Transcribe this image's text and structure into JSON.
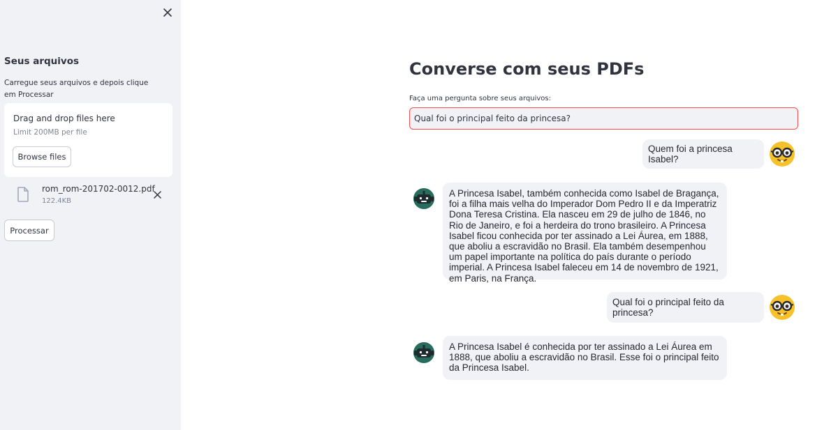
{
  "sidebar": {
    "close_icon": "close-icon",
    "title": "Seus arquivos",
    "caption": "Carregue seus arquivos e depois clique em Processar",
    "uploader": {
      "drag_text": "Drag and drop files here",
      "limit_text": "Limit 200MB per file",
      "browse_label": "Browse files"
    },
    "file": {
      "icon": "file-icon",
      "name": "rom_rom-201702-0012.pdf",
      "size": "122.4KB"
    },
    "process_label": "Processar"
  },
  "main": {
    "title": "Converse com seus PDFs",
    "question_label": "Faça uma pergunta sobre seus arquivos:",
    "question_value": "Qual foi o principal feito da princesa?"
  },
  "chat": [
    {
      "role": "user",
      "avatar": "nerd-face-avatar",
      "text": "Quem foi a princesa Isabel?"
    },
    {
      "role": "bot",
      "avatar": "robot-avatar",
      "text": "A Princesa Isabel, também conhecida como Isabel de Bragança, foi a filha mais velha do Imperador Dom Pedro II e da Imperatriz Dona Teresa Cristina. Ela nasceu em 29 de julho de 1846, no Rio de Janeiro, e foi a herdeira do trono brasileiro. A Princesa Isabel ficou conhecida por ter assinado a Lei Áurea, em 1888, que aboliu a escravidão no Brasil. Ela também desempenhou um papel importante na política do país durante o período imperial. A Princesa Isabel faleceu em 14 de novembro de 1921, em Paris, na França."
    },
    {
      "role": "user",
      "avatar": "nerd-face-avatar",
      "text": "Qual foi o principal feito da princesa?"
    },
    {
      "role": "bot",
      "avatar": "robot-avatar",
      "text": "A Princesa Isabel é conhecida por ter assinado a Lei Áurea em 1888, que aboliu a escravidão no Brasil. Esse foi o principal feito da Princesa Isabel."
    }
  ],
  "colors": {
    "sidebar_bg": "#f0f2f6",
    "bubble_bg": "#f0f2f6",
    "input_border_focus": "#ff4b4b",
    "text": "#31333f",
    "user_avatar": "#f7c12a",
    "bot_avatar": "#2e7d6b"
  }
}
